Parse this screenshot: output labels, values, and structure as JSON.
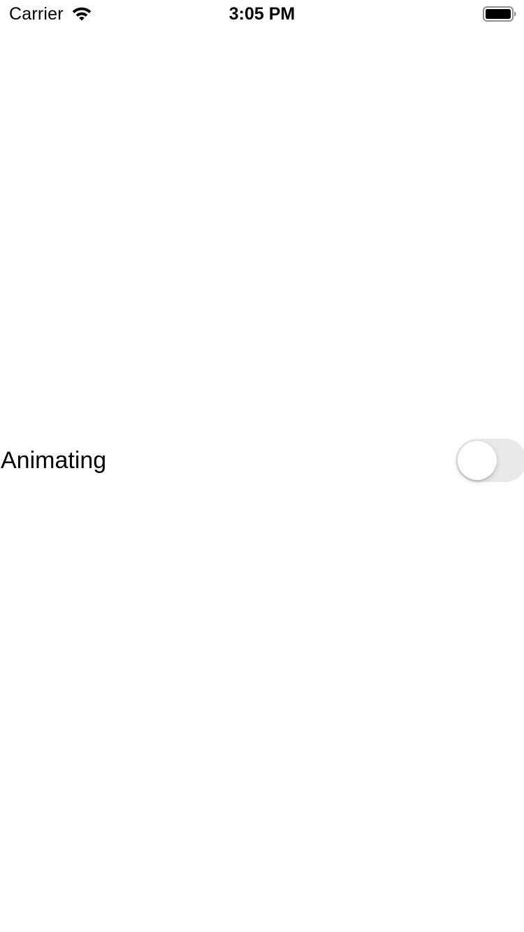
{
  "status_bar": {
    "carrier": "Carrier",
    "time": "3:05 PM",
    "wifi_icon": "wifi-icon",
    "battery_icon": "battery-full-icon"
  },
  "row": {
    "label": "Animating",
    "toggle_on": false,
    "toggle_off_color": "#e9e9ea",
    "toggle_knob_color": "#ffffff"
  }
}
